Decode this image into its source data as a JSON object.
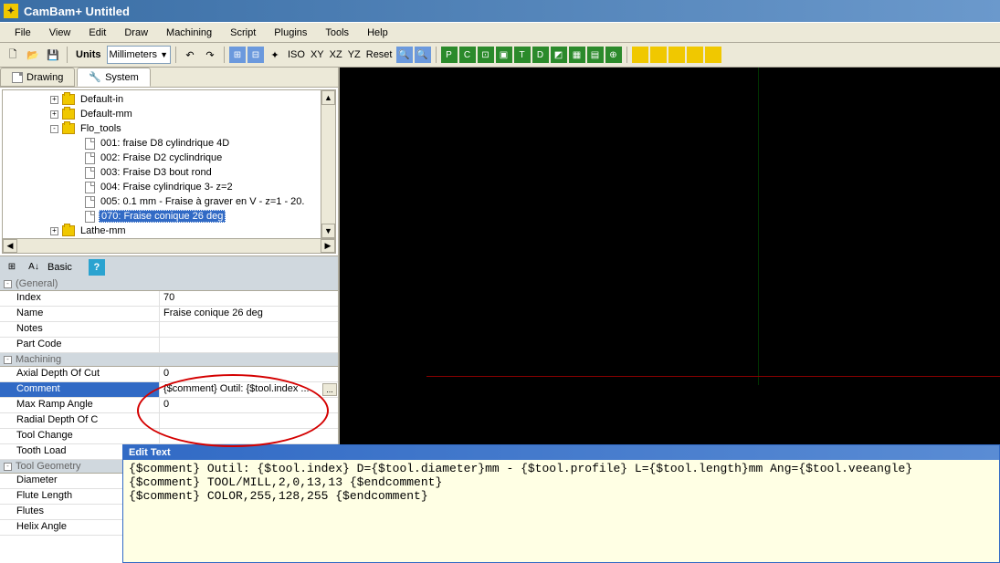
{
  "window": {
    "title": "CamBam+  Untitled"
  },
  "menu": [
    "File",
    "View",
    "Edit",
    "Draw",
    "Machining",
    "Script",
    "Plugins",
    "Tools",
    "Help"
  ],
  "toolbar": {
    "units_label": "Units",
    "units_value": "Millimeters",
    "iso": "ISO",
    "xy": "XY",
    "xz": "XZ",
    "yz": "YZ",
    "reset": "Reset"
  },
  "tabs": {
    "drawing": "Drawing",
    "system": "System"
  },
  "tree": {
    "items": [
      {
        "indent": 50,
        "exp": "+",
        "icon": "folder",
        "label": "Default-in"
      },
      {
        "indent": 50,
        "exp": "+",
        "icon": "folder",
        "label": "Default-mm"
      },
      {
        "indent": 50,
        "exp": "-",
        "icon": "folder",
        "label": "Flo_tools"
      },
      {
        "indent": 88,
        "icon": "page",
        "label": "001: fraise D8 cylindrique 4D"
      },
      {
        "indent": 88,
        "icon": "page",
        "label": "002: Fraise D2 cyclindrique"
      },
      {
        "indent": 88,
        "icon": "page",
        "label": "003: Fraise D3 bout rond"
      },
      {
        "indent": 88,
        "icon": "page",
        "label": "004: Fraise cylindrique 3- z=2"
      },
      {
        "indent": 88,
        "icon": "page",
        "label": "005: 0.1 mm - Fraise à graver en V - z=1 - 20."
      },
      {
        "indent": 88,
        "icon": "page",
        "label": "070: Fraise conique 26 deg",
        "selected": true
      },
      {
        "indent": 50,
        "exp": "+",
        "icon": "folder",
        "label": "Lathe-mm"
      }
    ]
  },
  "prop_toolbar": {
    "mode": "Basic"
  },
  "properties": {
    "categories": [
      {
        "name": "(General)",
        "rows": [
          {
            "name": "Index",
            "value": "70"
          },
          {
            "name": "Name",
            "value": "Fraise conique 26 deg"
          },
          {
            "name": "Notes",
            "value": ""
          },
          {
            "name": "Part Code",
            "value": ""
          }
        ]
      },
      {
        "name": "Machining",
        "rows": [
          {
            "name": "Axial Depth Of Cut",
            "value": "0"
          },
          {
            "name": "Comment",
            "value": "{$comment} Outil: {$tool.index ...",
            "selected": true,
            "btn": true
          },
          {
            "name": "Max Ramp Angle",
            "value": "0"
          },
          {
            "name": "Radial Depth Of C",
            "value": ""
          },
          {
            "name": "Tool Change",
            "value": ""
          },
          {
            "name": "Tooth Load",
            "value": ""
          }
        ]
      },
      {
        "name": "Tool Geometry",
        "rows": [
          {
            "name": "Diameter",
            "value": ""
          },
          {
            "name": "Flute Length",
            "value": ""
          },
          {
            "name": "Flutes",
            "value": ""
          },
          {
            "name": "Helix Angle",
            "value": ""
          }
        ]
      }
    ]
  },
  "edit_panel": {
    "title": "Edit Text",
    "content": "{$comment} Outil: {$tool.index} D={$tool.diameter}mm - {$tool.profile} L={$tool.length}mm Ang={$tool.veeangle}\n{$comment} TOOL/MILL,2,0,13,13 {$endcomment}\n{$comment} COLOR,255,128,255 {$endcomment}"
  }
}
